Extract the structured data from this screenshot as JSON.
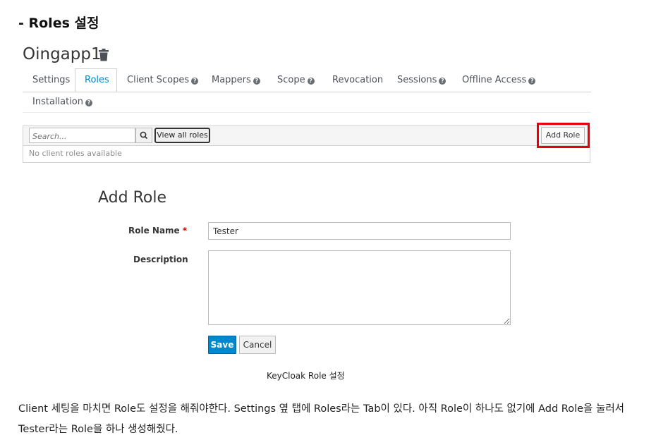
{
  "heading": "- Roles 설정",
  "app": {
    "title": "Oingapp1",
    "delete_icon": "trash-icon"
  },
  "tabs": [
    {
      "label": "Settings",
      "help": false
    },
    {
      "label": "Roles",
      "help": false,
      "active": true
    },
    {
      "label": "Client Scopes",
      "help": true
    },
    {
      "label": "Mappers",
      "help": true
    },
    {
      "label": "Scope",
      "help": true
    },
    {
      "label": "Revocation",
      "help": false
    },
    {
      "label": "Sessions",
      "help": true
    },
    {
      "label": "Offline Access",
      "help": true
    },
    {
      "label": "Installation",
      "help": true
    }
  ],
  "toolbar": {
    "search_placeholder": "Search...",
    "search_icon": "search-icon",
    "view_all_label": "View all roles",
    "add_role_label": "Add Role"
  },
  "table": {
    "empty_message": "No client roles available"
  },
  "form": {
    "title": "Add Role",
    "role_name_label": "Role Name",
    "required_mark": "*",
    "role_name_value": "Tester",
    "description_label": "Description",
    "description_value": "",
    "save_label": "Save",
    "cancel_label": "Cancel"
  },
  "caption": "KeyCloak Role 설정",
  "body_text": "Client 세팅을 마치면 Role도 설정을 해줘야한다. Settings 옆 탭에 Roles라는 Tab이 있다. 아직 Role이 하나도 없기에 Add Role을 눌러서 Tester라는 Role을 하나 생성해줬다.",
  "colors": {
    "accent": "#0088ce",
    "highlight": "#e3000b",
    "active_tab": "#0088ce"
  }
}
